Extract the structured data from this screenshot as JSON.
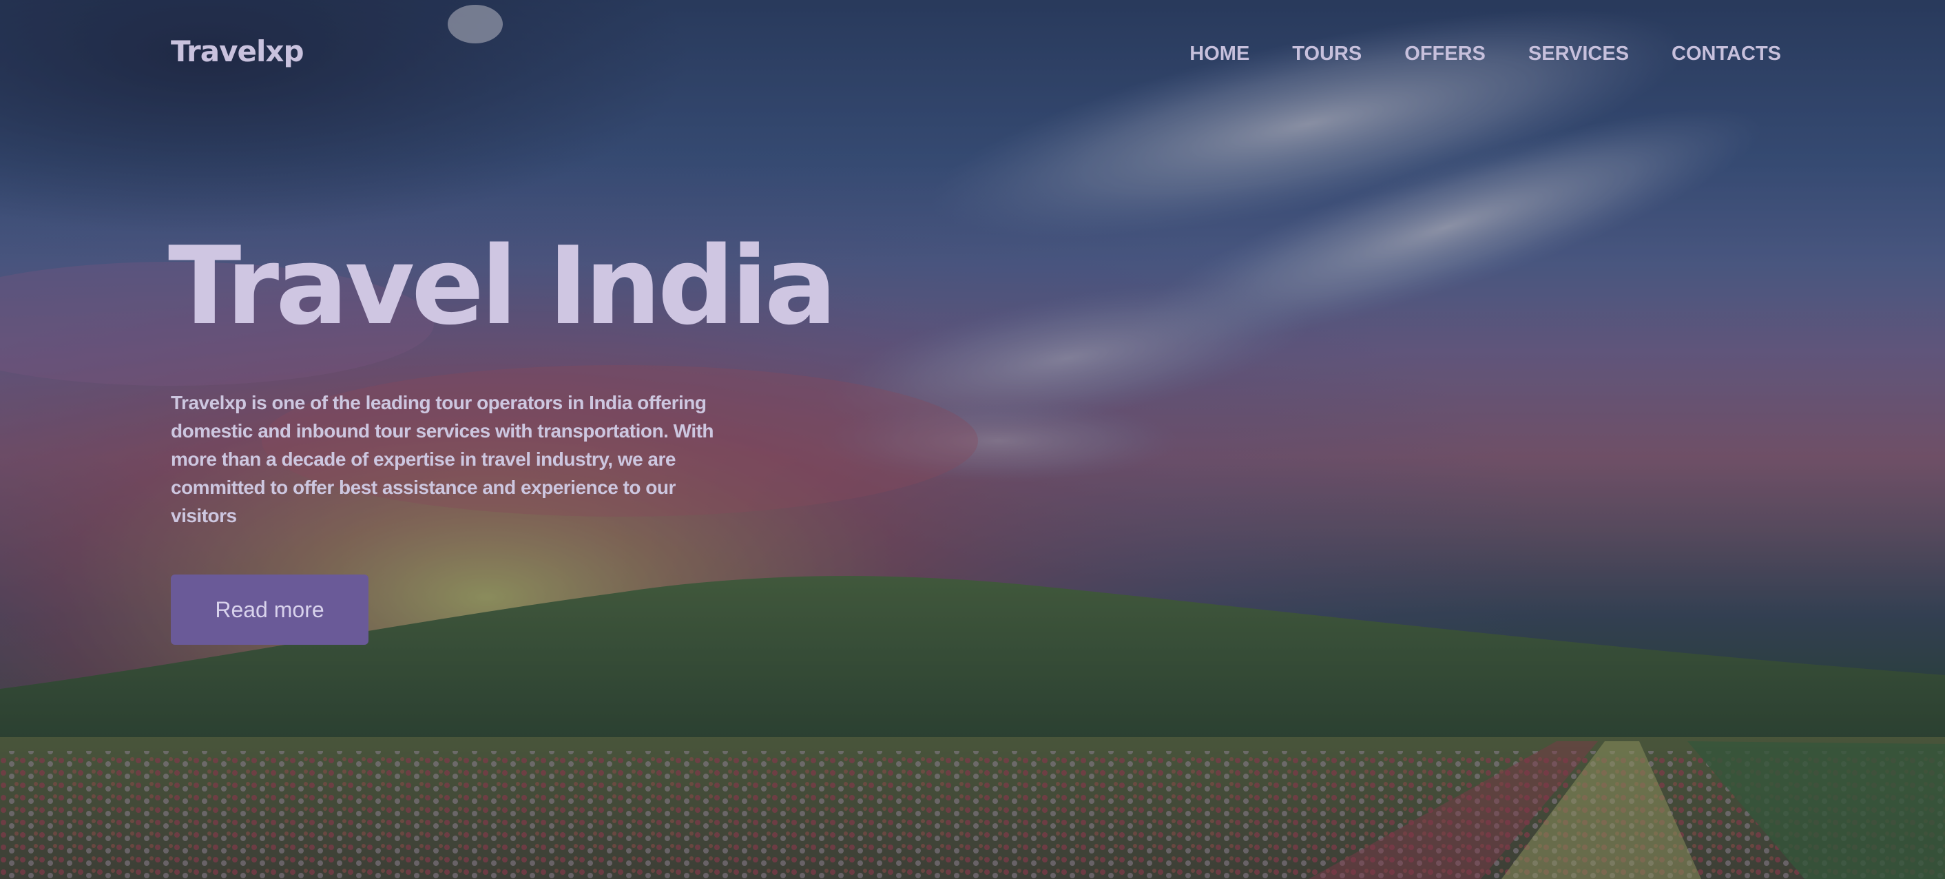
{
  "brand": {
    "name": "Travelxp"
  },
  "nav": {
    "items": [
      {
        "label": "HOME"
      },
      {
        "label": "TOURS"
      },
      {
        "label": "OFFERS"
      },
      {
        "label": "SERVICES"
      },
      {
        "label": "CONTACTS"
      }
    ]
  },
  "hero": {
    "title": "Travel India",
    "description": "Travelxp is one of the leading tour operators in India offering domestic and inbound tour services with transportation. With more than a decade of expertise in travel industry, we are committed to offer best assistance and experience to our visitors",
    "button_label": "Read more"
  },
  "colors": {
    "accent": "#6a5a98",
    "text": "#c9c2de"
  }
}
